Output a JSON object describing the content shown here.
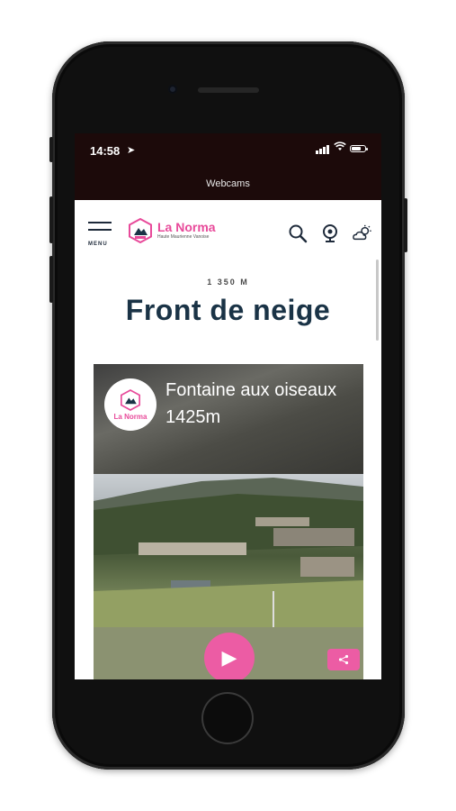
{
  "status_bar": {
    "time": "14:58",
    "location_icon": "location-arrow-icon",
    "signal_icon": "cellular-signal-icon",
    "wifi_icon": "wifi-icon",
    "battery_icon": "battery-icon"
  },
  "browser": {
    "page_title": "Webcams"
  },
  "header": {
    "menu_label": "MENU",
    "logo_name": "La Norma",
    "logo_subtitle": "Haute Maurienne Vanoise",
    "icons": [
      "search-icon",
      "webcam-icon",
      "weather-icon"
    ]
  },
  "main": {
    "altitude": "1 350 M",
    "title": "Front de neige"
  },
  "webcam_card": {
    "logo_name": "La Norma",
    "title": "Fontaine aux oiseaux 1425m",
    "play_icon": "play-icon",
    "share_icon": "share-icon"
  },
  "colors": {
    "brand_pink": "#ec5ca4",
    "title_navy": "#1a3346",
    "statusbar_bg": "#1c0a0a"
  }
}
